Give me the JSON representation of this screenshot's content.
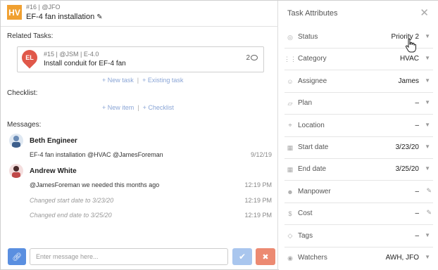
{
  "task": {
    "badge": "HV",
    "meta": "#16 | @JFO",
    "title": "EF-4 fan installation"
  },
  "related": {
    "label": "Related Tasks:",
    "card": {
      "avatar": "EL",
      "meta": "#15 | @JSM | E-4.0",
      "title": "Install conduit for EF-4 fan",
      "count": "2"
    },
    "new_task": "+ New task",
    "existing_task": "+ Existing task"
  },
  "checklist": {
    "label": "Checklist:",
    "new_item": "+ New item",
    "add_checklist": "+ Checklist"
  },
  "messages": {
    "label": "Messages:",
    "items": [
      {
        "author": "Beth Engineer",
        "text": "EF-4 fan installation @HVAC @JamesForeman",
        "time": "9/12/19"
      },
      {
        "author": "Andrew White",
        "text": "@JamesForeman we needed this months ago",
        "time": "12:19 PM"
      },
      {
        "text": "Changed start date to 3/23/20",
        "time": "12:19 PM"
      },
      {
        "text": "Changed end date to 3/25/20",
        "time": "12:19 PM"
      }
    ],
    "input_placeholder": "Enter message here..."
  },
  "attributes": {
    "title": "Task Attributes",
    "rows": [
      {
        "icon": "status-icon",
        "label": "Status",
        "value": "Priority 2",
        "control": "caret"
      },
      {
        "icon": "category-icon",
        "label": "Category",
        "value": "HVAC",
        "control": "caret"
      },
      {
        "icon": "user-icon",
        "label": "Assignee",
        "value": "James",
        "control": "caret"
      },
      {
        "icon": "plan-icon",
        "label": "Plan",
        "value": "–",
        "control": "caret"
      },
      {
        "icon": "location-icon",
        "label": "Location",
        "value": "–",
        "control": "caret"
      },
      {
        "icon": "calendar-icon",
        "label": "Start date",
        "value": "3/23/20",
        "control": "caret"
      },
      {
        "icon": "calendar-icon",
        "label": "End date",
        "value": "3/25/20",
        "control": "caret"
      },
      {
        "icon": "people-icon",
        "label": "Manpower",
        "value": "–",
        "control": "edit"
      },
      {
        "icon": "dollar-icon",
        "label": "Cost",
        "value": "–",
        "control": "edit"
      },
      {
        "icon": "tag-icon",
        "label": "Tags",
        "value": "–",
        "control": "caret"
      },
      {
        "icon": "eye-icon",
        "label": "Watchers",
        "value": "AWH, JFO",
        "control": "caret"
      }
    ]
  },
  "colors": {
    "badge": "#f0a030",
    "link": "#8aa5d6",
    "primary": "#5a8fe0",
    "send": "#a9c6ee",
    "cancel": "#ec8a72",
    "avatar_pin": "#e0584a"
  }
}
